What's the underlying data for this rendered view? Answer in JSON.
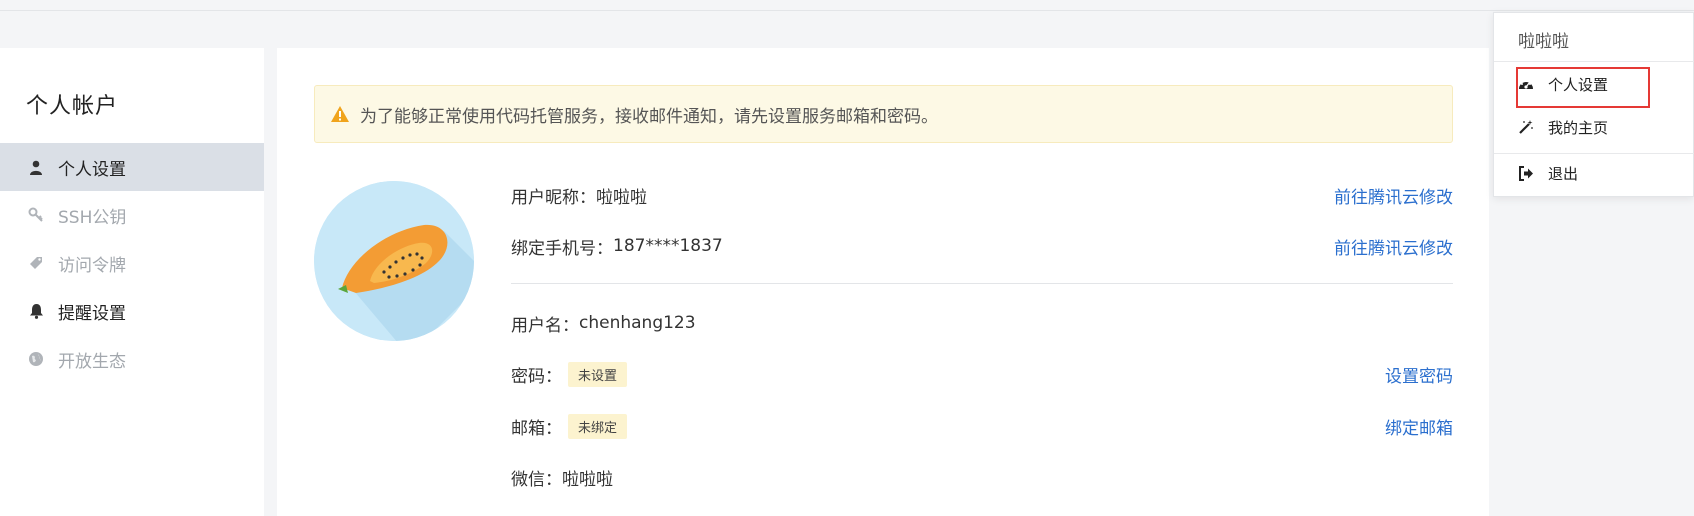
{
  "colors": {
    "accent_link": "#2b6fce",
    "alert_bg": "#fdf9e5",
    "alert_icon": "#f0a41c",
    "tag_bg": "#fcf3cf",
    "active_bg": "#dadfe6",
    "highlight": "#e53935"
  },
  "sidebar": {
    "title": "个人帐户",
    "items": [
      {
        "label": "个人设置",
        "icon": "user-icon",
        "state": "active"
      },
      {
        "label": "SSH公钥",
        "icon": "key-icon",
        "state": "muted"
      },
      {
        "label": "访问令牌",
        "icon": "tag-icon",
        "state": "muted"
      },
      {
        "label": "提醒设置",
        "icon": "bell-icon",
        "state": "dark"
      },
      {
        "label": "开放生态",
        "icon": "globe-icon",
        "state": "muted"
      }
    ]
  },
  "alert": {
    "icon": "warning-icon",
    "text": "为了能够正常使用代码托管服务，接收邮件通知，请先设置服务邮箱和密码。"
  },
  "profile": {
    "avatar": "papaya-avatar",
    "nickname_label": "用户昵称：",
    "nickname": "啦啦啦",
    "nickname_action": "前往腾讯云修改",
    "phone_label": "绑定手机号：",
    "phone": "187****1837",
    "phone_action": "前往腾讯云修改",
    "username_label": "用户名：",
    "username": "chenhang123",
    "password_label": "密码：",
    "password_tag": "未设置",
    "password_action": "设置密码",
    "email_label": "邮箱：",
    "email_tag": "未绑定",
    "email_action": "绑定邮箱",
    "wechat_label": "微信：",
    "wechat": "啦啦啦"
  },
  "dropdown": {
    "username": "啦啦啦",
    "items": [
      {
        "label": "个人设置",
        "icon": "dashboard-icon",
        "highlighted": true
      },
      {
        "label": "我的主页",
        "icon": "magic-wand-icon"
      },
      {
        "label": "退出",
        "icon": "sign-out-icon"
      }
    ]
  }
}
